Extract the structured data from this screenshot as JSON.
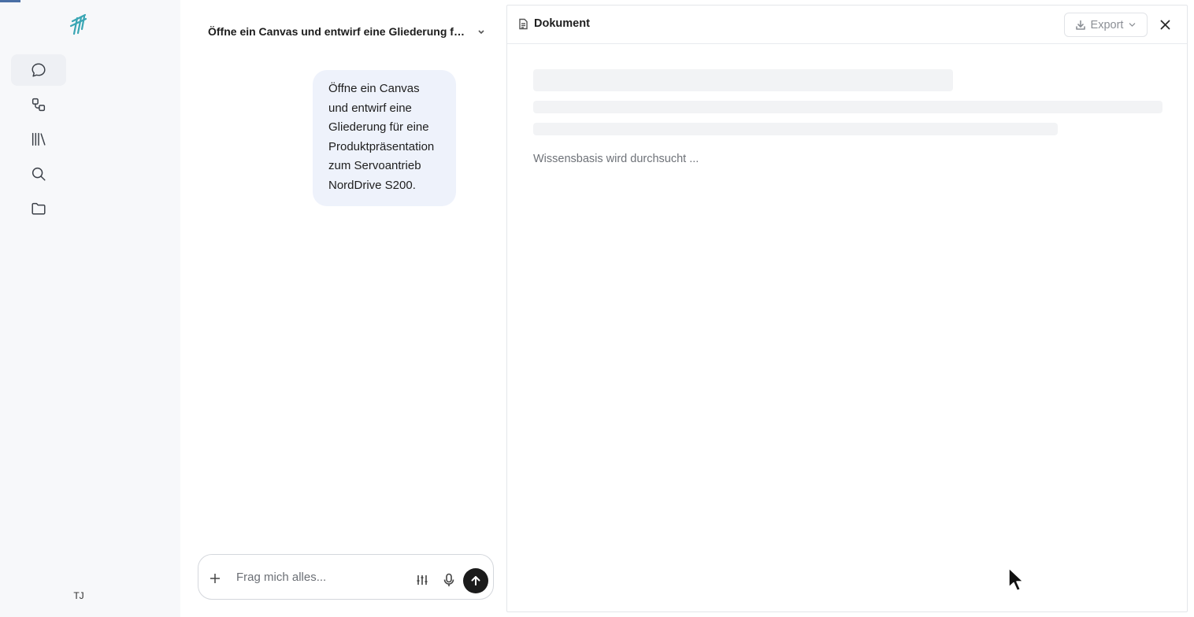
{
  "rail": {
    "items": [
      {
        "name": "chat",
        "icon": "chat-bubble-icon",
        "active": true
      },
      {
        "name": "workflows",
        "icon": "workflow-icon",
        "active": false
      },
      {
        "name": "library",
        "icon": "library-icon",
        "active": false
      },
      {
        "name": "search",
        "icon": "search-icon",
        "active": false
      },
      {
        "name": "folders",
        "icon": "folder-icon",
        "active": false
      }
    ],
    "user_initials": "TJ",
    "logo_color": "#3aa6b4"
  },
  "chat": {
    "title": "Öffne ein Canvas und entwirf eine Gliederung für eine Produktpräsentation zum Servoantrieb NordDrive S200.",
    "messages": [
      {
        "role": "user",
        "text": "Öffne ein Canvas und entwirf eine Gliederung für eine Produktpräsentation zum Servoantrieb NordDrive S200."
      }
    ],
    "composer": {
      "placeholder": "Frag mich alles...",
      "value": ""
    }
  },
  "document": {
    "title": "Dokument",
    "export_label": "Export",
    "status": "Wissensbasis wird durchsucht ..."
  },
  "colors": {
    "accent": "#1b1b1b",
    "bubble": "#eef2fb",
    "rail_bg": "#f7f8fa"
  }
}
